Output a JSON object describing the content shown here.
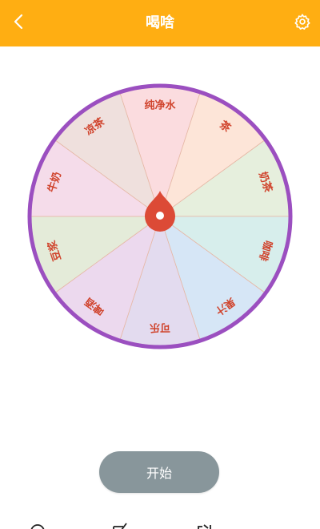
{
  "header": {
    "title": "喝啥",
    "back_icon": "chevron-left-icon",
    "settings_icon": "gear-icon",
    "background_color": "#ffae12"
  },
  "wheel": {
    "border_color": "#9b4fc0",
    "pointer_color": "#dc4a36",
    "segments": [
      {
        "label": "纯净水",
        "color": "#fbdcdf"
      },
      {
        "label": "茶",
        "color": "#fde5d8"
      },
      {
        "label": "奶茶",
        "color": "#e6efdd"
      },
      {
        "label": "咖啡",
        "color": "#d7eeec"
      },
      {
        "label": "果汁",
        "color": "#d6e6f6"
      },
      {
        "label": "可乐",
        "color": "#e3dbef"
      },
      {
        "label": "啤酒",
        "color": "#ecd9ee"
      },
      {
        "label": "豆浆",
        "color": "#e4ebd9"
      },
      {
        "label": "牛奶",
        "color": "#f5dcea"
      },
      {
        "label": "凉茶",
        "color": "#efe0dd"
      }
    ]
  },
  "actions": {
    "start_label": "开始"
  },
  "bottom_bar_icons": [
    "search-icon",
    "edit-icon",
    "share-icon"
  ]
}
